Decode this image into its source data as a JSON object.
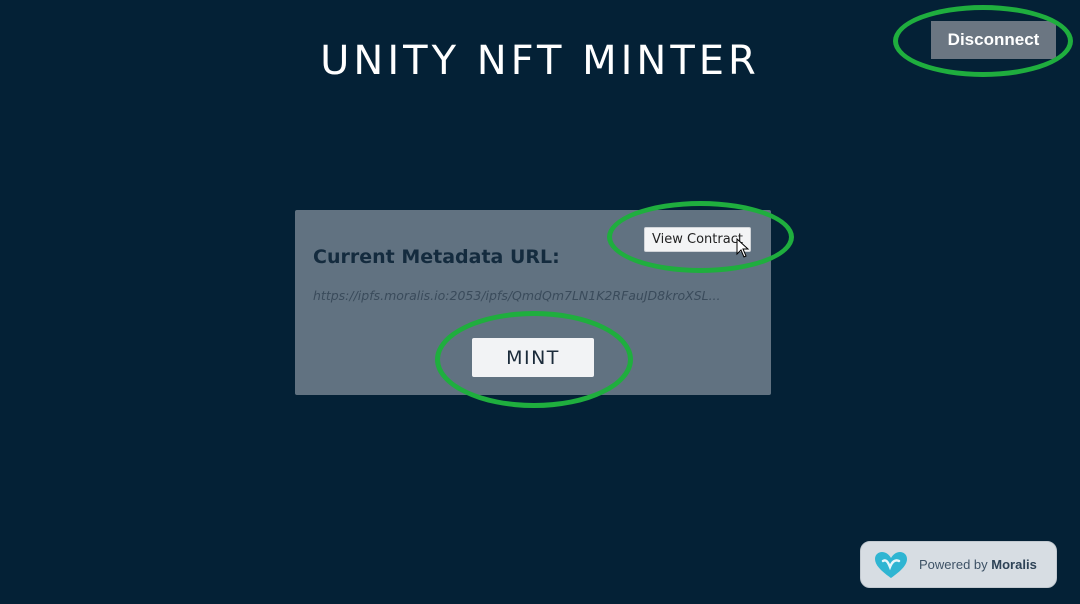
{
  "header": {
    "title": "UNITY NFT MINTER",
    "disconnect_label": "Disconnect"
  },
  "panel": {
    "metadata_label": "Current Metadata URL:",
    "metadata_url": "https://ipfs.moralis.io:2053/ipfs/QmdQm7LN1K2RFauJD8kroXSL...",
    "view_contract_label": "View Contract",
    "mint_label": "MINT"
  },
  "footer": {
    "powered_prefix": "Powered by",
    "powered_brand": "Moralis",
    "logo_icon": "moralis-heart-icon"
  },
  "colors": {
    "background": "#042136",
    "panel": "#617281",
    "highlight_ring": "#1fae3e",
    "disconnect_button": "#6b7682",
    "button_light": "#f2f3f5"
  },
  "cursor_icon": "arrow-cursor-icon"
}
